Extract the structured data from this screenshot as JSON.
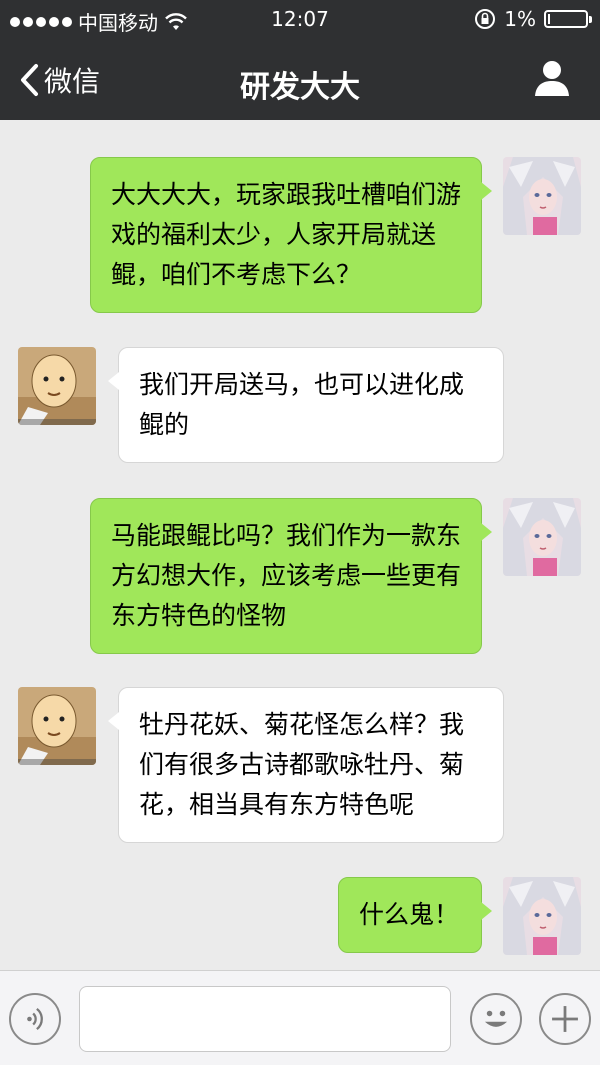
{
  "status_bar": {
    "carrier": "中国移动",
    "time": "12:07",
    "battery": "1%"
  },
  "nav": {
    "back_label": "微信",
    "title": "研发大大"
  },
  "messages": [
    {
      "side": "sent",
      "sender": "me",
      "text": "大大大大，玩家跟我吐槽咱们游戏的福利太少，人家开局就送鲲，咱们不考虑下么？"
    },
    {
      "side": "recv",
      "sender": "dev",
      "text": "我们开局送马，也可以进化成鲲的"
    },
    {
      "side": "sent",
      "sender": "me",
      "text": "马能跟鲲比吗？我们作为一款东方幻想大作，应该考虑一些更有东方特色的怪物"
    },
    {
      "side": "recv",
      "sender": "dev",
      "text": "牡丹花妖、菊花怪怎么样？我们有很多古诗都歌咏牡丹、菊花，相当具有东方特色呢"
    },
    {
      "side": "sent",
      "sender": "me",
      "text": "什么鬼！"
    }
  ],
  "input": {
    "value": "",
    "placeholder": ""
  },
  "colors": {
    "header_bg": "#2f3032",
    "sent_bubble": "#a0e75a",
    "recv_bubble": "#ffffff",
    "chat_bg": "#ebebeb"
  },
  "icons": {
    "voice": "voice-icon",
    "emoji": "emoji-icon",
    "plus": "plus-icon",
    "back": "chevron-left-icon",
    "profile": "person-icon"
  }
}
